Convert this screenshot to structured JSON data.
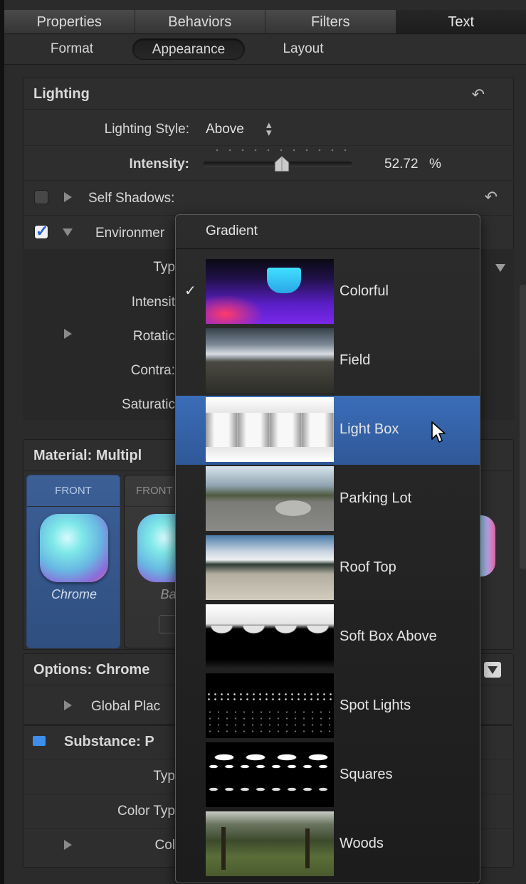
{
  "tabs": [
    "Properties",
    "Behaviors",
    "Filters",
    "Text"
  ],
  "subtabs": [
    "Format",
    "Appearance",
    "Layout"
  ],
  "lighting": {
    "title": "Lighting",
    "style_label": "Lighting Style:",
    "style_value": "Above",
    "intensity_label": "Intensity:",
    "intensity_value": "52.72",
    "intensity_unit": "%",
    "self_shadows_label": "Self Shadows:",
    "environment_label": "Environmer",
    "type_label": "Typ",
    "env_intensity_label": "Intensit",
    "rotation_label": "Rotatic",
    "contrast_label": "Contra:",
    "saturation_label": "Saturatic"
  },
  "material": {
    "title": "Material:  Multipl",
    "tiles": [
      {
        "head": "FRONT",
        "name": "Chrome"
      },
      {
        "head": "FRONT",
        "name": "Bas"
      }
    ]
  },
  "options": {
    "title": "Options: Chrome",
    "global_label": "Global Plac"
  },
  "substance": {
    "title": "Substance:  P",
    "type_label": "Typ",
    "color_type_label": "Color Typ",
    "color_label": "Col"
  },
  "menu": {
    "title": "Gradient",
    "items": [
      {
        "label": "Colorful",
        "checked": true
      },
      {
        "label": "Field"
      },
      {
        "label": "Light Box",
        "selected": true
      },
      {
        "label": "Parking Lot"
      },
      {
        "label": "Roof Top"
      },
      {
        "label": "Soft Box Above"
      },
      {
        "label": "Spot Lights"
      },
      {
        "label": "Squares"
      },
      {
        "label": "Woods"
      }
    ]
  },
  "icons": {
    "reset": "reset-arrow-icon",
    "stepper": "stepper-arrows-icon",
    "disclosure": "disclosure-triangle-icon",
    "cursor": "mouse-pointer-icon"
  }
}
